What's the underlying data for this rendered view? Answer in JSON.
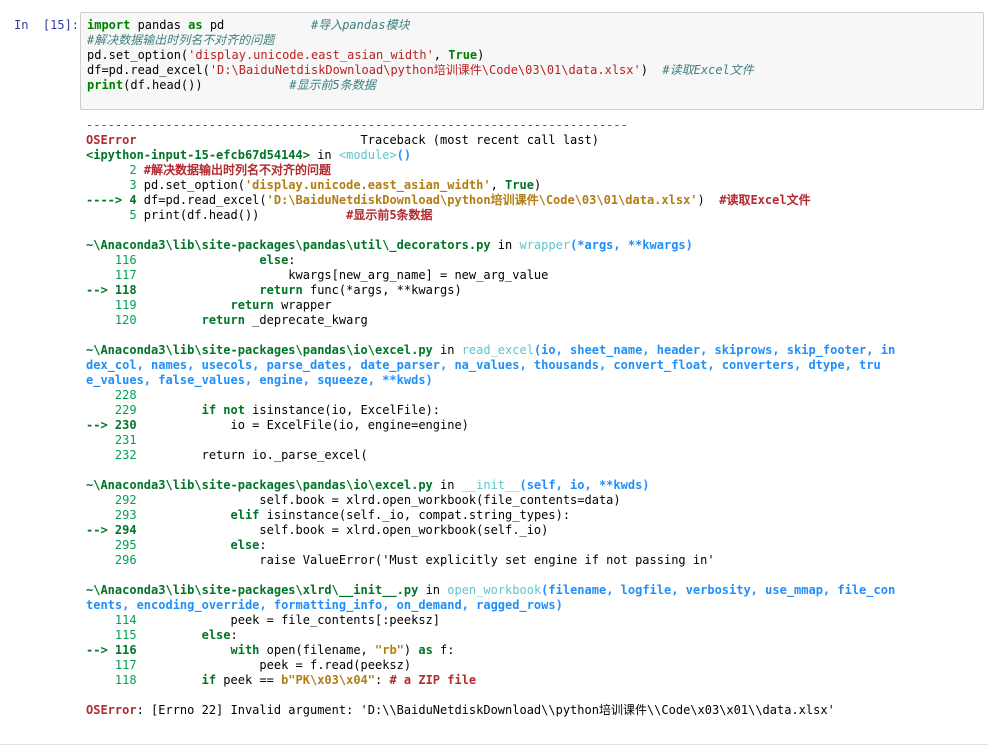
{
  "prompt": "In  [15]:",
  "code": {
    "line1_kw1": "import",
    "line1_mid": " pandas ",
    "line1_kw2": "as",
    "line1_rest": " pd            ",
    "line1_comment": "#导入pandas模块",
    "line2_comment": "#解决数据输出时列名不对齐的问题",
    "line3_a": "pd.set_option(",
    "line3_str": "'display.unicode.east_asian_width'",
    "line3_b": ", ",
    "line3_true": "True",
    "line3_c": ")",
    "line4_a": "df=pd.read_excel(",
    "line4_str": "'D:\\BaiduNetdiskDownload\\python培训课件\\Code\\03\\01\\data.xlsx'",
    "line4_b": ")  ",
    "line4_comment": "#读取Excel文件",
    "line5_kw": "print",
    "line5_rest": "(df.head())            ",
    "line5_comment": "#显示前5条数据"
  },
  "traceback": {
    "dashes": "---------------------------------------------------------------------------",
    "error_name": "OSError",
    "header_rest": "                               Traceback (most recent call last)",
    "input_ref": "<ipython-input-15-efcb67d54144>",
    "in_word": " in ",
    "module": "<module>",
    "module_parens": "()",
    "f0_l2_num": "      2 ",
    "f0_l2_code": "#解决数据输出时列名不对齐的问题",
    "f0_l3_num": "      3 ",
    "f0_l3_a": "pd.set_option(",
    "f0_l3_str": "'display.unicode.east_asian_width'",
    "f0_l3_b": ", ",
    "f0_l3_true": "True",
    "f0_l3_c": ")",
    "f0_arrow": "----> 4 ",
    "f0_l4_a": "df=pd.read_excel(",
    "f0_l4_str": "'D:\\BaiduNetdiskDownload\\python培训课件\\Code\\03\\01\\data.xlsx'",
    "f0_l4_b": ")  ",
    "f0_l4_comment": "#读取Excel文件",
    "f0_l5_num": "      5 ",
    "f0_l5_a": "print(df.head())            ",
    "f0_l5_comment": "#显示前5条数据",
    "f1_path": "~\\Anaconda3\\lib\\site-packages\\pandas\\util\\_decorators.py",
    "f1_func": "wrapper",
    "f1_args": "(*args, **kwargs)",
    "f1_l116_num": "    116 ",
    "f1_l116_kw": "                else",
    "f1_l116_rest": ":",
    "f1_l117_num": "    117 ",
    "f1_l117_code": "                    kwargs[new_arg_name] = new_arg_value",
    "f1_arrow": "--> 118 ",
    "f1_l118_pre": "                ",
    "f1_l118_kw": "return",
    "f1_l118_rest": " func(*args, **kwargs)",
    "f1_l119_num": "    119 ",
    "f1_l119_pre": "            ",
    "f1_l119_kw": "return",
    "f1_l119_rest": " wrapper",
    "f1_l120_num": "    120 ",
    "f1_l120_pre": "        ",
    "f1_l120_kw": "return",
    "f1_l120_rest": " _deprecate_kwarg",
    "f2_path": "~\\Anaconda3\\lib\\site-packages\\pandas\\io\\excel.py",
    "f2_func": "read_excel",
    "f2_args1": "(io, sheet_name, header, skiprows, skip_footer, in",
    "f2_args2": "dex_col, names, usecols, parse_dates, date_parser, na_values, thousands, convert_float, converters, dtype, tru",
    "f2_args3": "e_values, false_values, engine, squeeze, **kwds)",
    "f2_l228_num": "    228 ",
    "f2_l229_num": "    229 ",
    "f2_l229_pre": "        ",
    "f2_l229_kw1": "if not",
    "f2_l229_rest": " isinstance(io, ExcelFile):",
    "f2_arrow": "--> 230 ",
    "f2_l230_code": "            io = ExcelFile(io, engine=engine)",
    "f2_l231_num": "    231 ",
    "f2_l232_num": "    232 ",
    "f2_l232_code": "        return io._parse_excel(",
    "f3_path": "~\\Anaconda3\\lib\\site-packages\\pandas\\io\\excel.py",
    "f3_func": "__init__",
    "f3_args": "(self, io, **kwds)",
    "f3_l292_num": "    292 ",
    "f3_l292_code": "                self.book = xlrd.open_workbook(file_contents=data)",
    "f3_l293_num": "    293 ",
    "f3_l293_pre": "            ",
    "f3_l293_kw": "elif",
    "f3_l293_rest": " isinstance(self._io, compat.string_types):",
    "f3_arrow": "--> 294 ",
    "f3_l294_code": "                self.book = xlrd.open_workbook(self._io)",
    "f3_l295_num": "    295 ",
    "f3_l295_pre": "            ",
    "f3_l295_kw": "else",
    "f3_l295_rest": ":",
    "f3_l296_num": "    296 ",
    "f3_l296_code": "                raise ValueError('Must explicitly set engine if not passing in'",
    "f4_path": "~\\Anaconda3\\lib\\site-packages\\xlrd\\__init__.py",
    "f4_func": "open_workbook",
    "f4_args1": "(filename, logfile, verbosity, use_mmap, file_con",
    "f4_args2": "tents, encoding_override, formatting_info, on_demand, ragged_rows)",
    "f4_l114_num": "    114 ",
    "f4_l114_code": "            peek = file_contents[:peeksz]",
    "f4_l115_num": "    115 ",
    "f4_l115_pre": "        ",
    "f4_l115_kw": "else",
    "f4_l115_rest": ":",
    "f4_arrow": "--> 116 ",
    "f4_l116_pre": "            ",
    "f4_l116_kw": "with",
    "f4_l116_a": " open(filename, ",
    "f4_l116_str": "\"rb\"",
    "f4_l116_b": ") ",
    "f4_l116_kw2": "as",
    "f4_l116_c": " f:",
    "f4_l117_num": "    117 ",
    "f4_l117_code": "                peek = f.read(peeksz)",
    "f4_l118_num": "    118 ",
    "f4_l118_pre": "        ",
    "f4_l118_kw": "if",
    "f4_l118_a": " peek == ",
    "f4_l118_str": "b\"PK\\x03\\x04\"",
    "f4_l118_b": ": ",
    "f4_l118_comment": "# a ZIP file",
    "final_error_name": "OSError",
    "final_error_msg": ": [Errno 22] Invalid argument: 'D:\\\\BaiduNetdiskDownload\\\\python培训课件\\\\Code\\x03\\x01\\\\data.xlsx'"
  }
}
